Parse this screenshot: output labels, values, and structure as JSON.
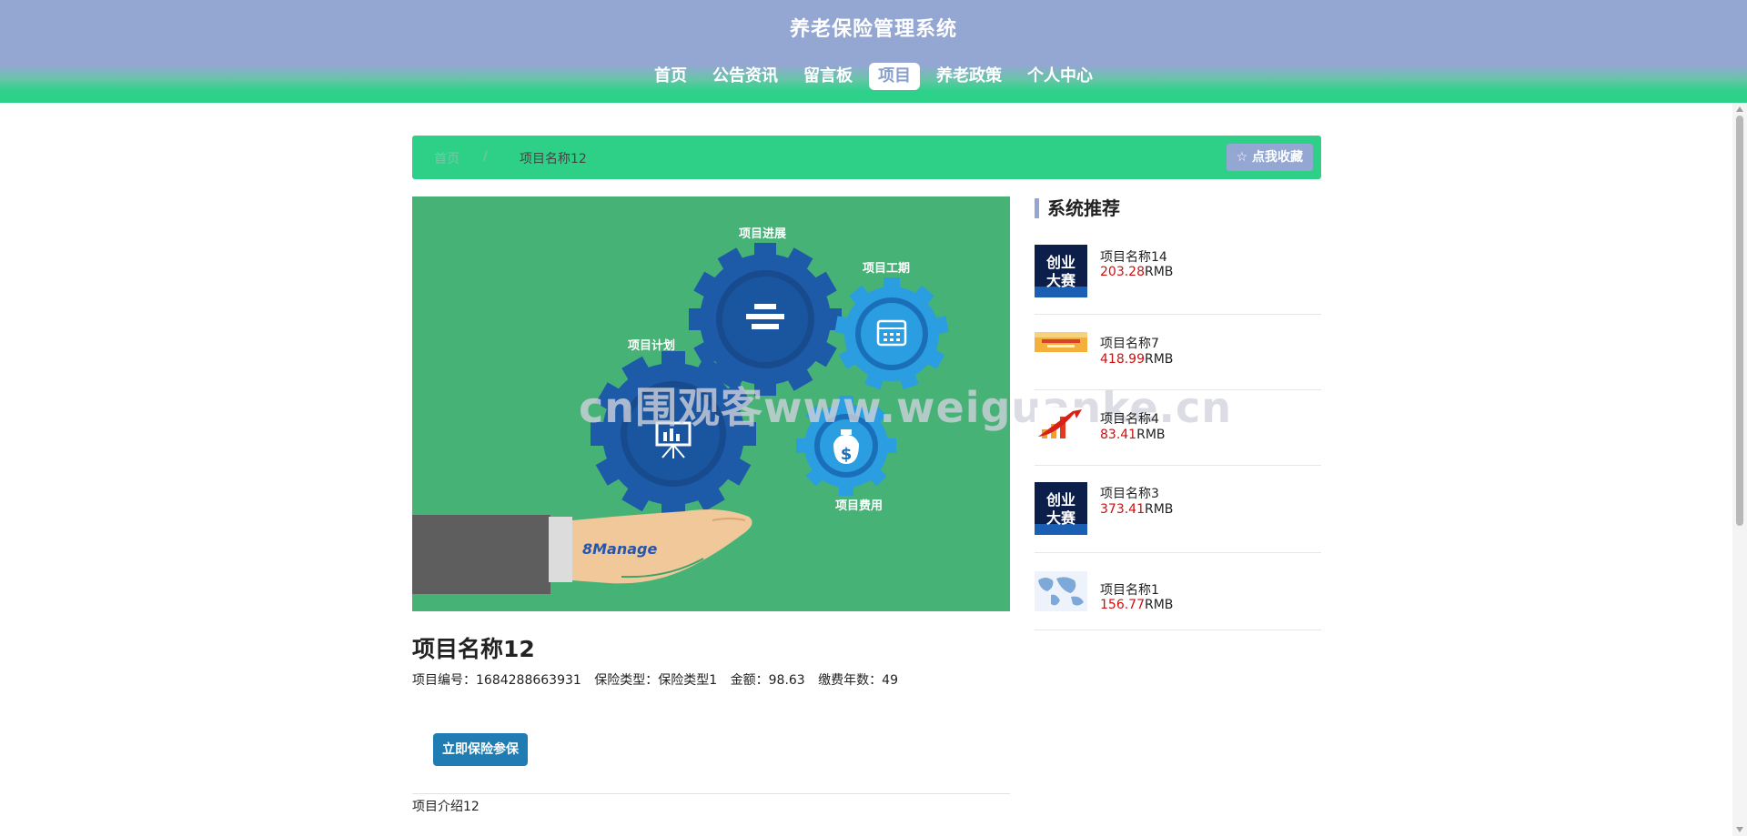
{
  "site": {
    "title": "养老保险管理系统"
  },
  "nav": [
    {
      "label": "首页"
    },
    {
      "label": "公告资讯"
    },
    {
      "label": "留言板"
    },
    {
      "label": "项目",
      "active": true
    },
    {
      "label": "养老政策"
    },
    {
      "label": "个人中心"
    }
  ],
  "breadcrumb": {
    "home": "首页",
    "separator": "/",
    "current": "项目名称12"
  },
  "favorite": {
    "icon": "star-outline-icon",
    "label": "☆ 点我收藏"
  },
  "hero": {
    "labels": {
      "progress": "项目进展",
      "schedule": "项目工期",
      "plan": "项目计划",
      "cost": "项目费用"
    },
    "brand": "8Manage"
  },
  "item": {
    "title": "项目名称12",
    "fields": [
      {
        "label": "项目编号：",
        "value": "1684288663931"
      },
      {
        "label": "保险类型：",
        "value": "保险类型1"
      },
      {
        "label": "金额：",
        "value": "98.63"
      },
      {
        "label": "缴费年数：",
        "value": "49"
      }
    ],
    "join_label": "立即保险参保",
    "intro": "项目介绍12"
  },
  "sidebar": {
    "title": "系统推荐",
    "items": [
      {
        "name": "项目名称14",
        "price": "203.28",
        "unit": "RMB",
        "thumb_text": [
          "创业",
          "大赛"
        ]
      },
      {
        "name": "项目名称7",
        "price": "418.99",
        "unit": "RMB"
      },
      {
        "name": "项目名称4",
        "price": "83.41",
        "unit": "RMB"
      },
      {
        "name": "项目名称3",
        "price": "373.41",
        "unit": "RMB",
        "thumb_text": [
          "创业",
          "大赛"
        ]
      },
      {
        "name": "项目名称1",
        "price": "156.77",
        "unit": "RMB"
      }
    ]
  },
  "watermark": "cn围观客www.weiguanke.cn",
  "colors": {
    "header": "#93a7d2",
    "green": "#2ed18a",
    "button": "#1f7db4",
    "price": "#cc1010"
  }
}
